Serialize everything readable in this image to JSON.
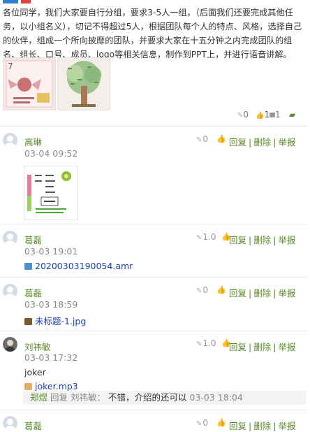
{
  "post": {
    "text": "各位同学，我们大家要自行分组，要求3-5人一组，（后面我们还要完成其他任务，以小组名义），切记不得超过5人，根据团队每个人的特点、风格，选择自己的伙伴，组成一个所向披靡的团队，并要求大家在十五分钟之内完成团队的组名、组长、口号、成员、logo等相关信息，制作到PPT上，并进行语音讲解。",
    "score": "0",
    "likes": "1",
    "comment_count": "1"
  },
  "actions": {
    "reply": "回复",
    "delete": "删除",
    "report": "举报",
    "sep": "|"
  },
  "comments": [
    {
      "name": "高琳",
      "date": "03-04 09:52",
      "score": "0"
    },
    {
      "name": "葛磊",
      "date": "03-03 19:01",
      "score": "1.0",
      "file": "20200303190054.amr"
    },
    {
      "name": "葛磊",
      "date": "03-03 18:59",
      "score": "0",
      "file": "未标题-1.jpg"
    },
    {
      "name": "刘祎敏",
      "date": "03-03 17:32",
      "score": "1.0",
      "text": "joker",
      "file": "joker.mp3"
    },
    {
      "name": "葛磊",
      "score": "0"
    }
  ],
  "reply": {
    "name": "郑煜",
    "label": "回复",
    "target": "刘祎敏",
    "colon": "：",
    "text": "不错，介绍的还可以",
    "date": "03-03 18:04"
  },
  "colors": {
    "accent": "#5a8a2a",
    "link": "#1a3fb5",
    "muted": "#888888"
  }
}
